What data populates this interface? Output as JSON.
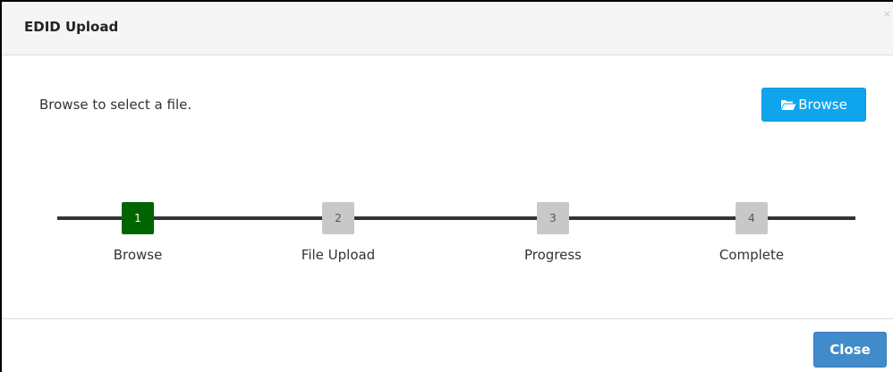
{
  "dialog": {
    "title": "EDID Upload",
    "close_x": "×"
  },
  "body": {
    "instruction": "Browse to select a file.",
    "browse_label": "Browse",
    "browse_icon": "folder-open-icon"
  },
  "stepper": {
    "current_step": 1,
    "steps": [
      {
        "number": "1",
        "label": "Browse",
        "status": "active"
      },
      {
        "number": "2",
        "label": "File Upload",
        "status": "inactive"
      },
      {
        "number": "3",
        "label": "Progress",
        "status": "inactive"
      },
      {
        "number": "4",
        "label": "Complete",
        "status": "inactive"
      }
    ]
  },
  "footer": {
    "close_label": "Close"
  },
  "colors": {
    "active_step": "#006400",
    "inactive_step": "#c8c8c8",
    "browse_button": "#0ea5ed",
    "close_button": "#428bca",
    "stepper_line": "#333333"
  }
}
